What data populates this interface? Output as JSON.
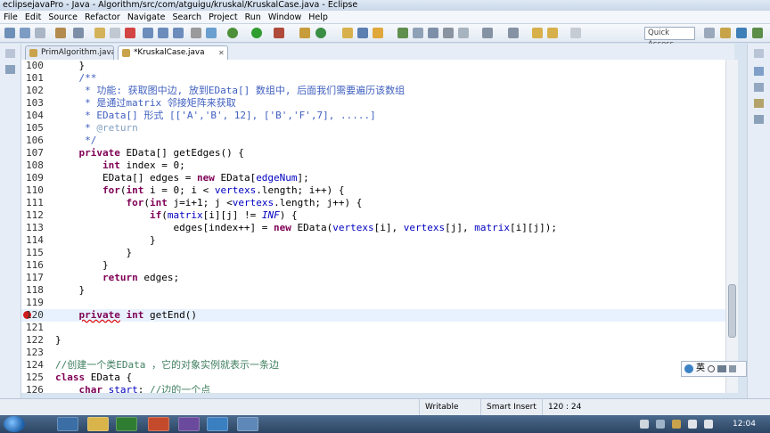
{
  "window": {
    "title": "eclipsejavaPro - Java - Algorithm/src/com/atguigu/kruskal/KruskalCase.java - Eclipse"
  },
  "menu": [
    "File",
    "Edit",
    "Source",
    "Refactor",
    "Navigate",
    "Search",
    "Project",
    "Run",
    "Window",
    "Help"
  ],
  "toolbar": {
    "quick_access": "Quick Access"
  },
  "tabs": [
    {
      "label": "PrimAlgorithm.java",
      "active": false
    },
    {
      "label": "*KruskalCase.java",
      "active": true
    }
  ],
  "editor": {
    "lines": [
      {
        "n": "100",
        "t": "    }"
      },
      {
        "n": "101",
        "t": "    /**"
      },
      {
        "n": "102",
        "t": "     * 功能: 获取图中边, 放到EData[] 数组中, 后面我们需要遍历该数组"
      },
      {
        "n": "103",
        "t": "     * 是通过matrix 邻接矩阵来获取"
      },
      {
        "n": "104",
        "t": "     * EData[] 形式 [['A','B', 12], ['B','F',7], .....]"
      },
      {
        "n": "105",
        "t": "     * @return"
      },
      {
        "n": "106",
        "t": "     */"
      },
      {
        "n": "107",
        "t": "    private EData[] getEdges() {"
      },
      {
        "n": "108",
        "t": "        int index = 0;"
      },
      {
        "n": "109",
        "t": "        EData[] edges = new EData[edgeNum];"
      },
      {
        "n": "110",
        "t": "        for(int i = 0; i < vertexs.length; i++) {"
      },
      {
        "n": "111",
        "t": "            for(int j=i+1; j <vertexs.length; j++) {"
      },
      {
        "n": "112",
        "t": "                if(matrix[i][j] != INF) {"
      },
      {
        "n": "113",
        "t": "                    edges[index++] = new EData(vertexs[i], vertexs[j], matrix[i][j]);"
      },
      {
        "n": "114",
        "t": "                }"
      },
      {
        "n": "115",
        "t": "            }"
      },
      {
        "n": "116",
        "t": "        }"
      },
      {
        "n": "117",
        "t": "        return edges;"
      },
      {
        "n": "118",
        "t": "    }"
      },
      {
        "n": "119",
        "t": ""
      },
      {
        "n": "120",
        "t": "    private int getEnd()"
      },
      {
        "n": "121",
        "t": ""
      },
      {
        "n": "122",
        "t": "}"
      },
      {
        "n": "123",
        "t": ""
      },
      {
        "n": "124",
        "t": "//创建一个类EData ，它的对象实例就表示一条边"
      },
      {
        "n": "125",
        "t": "class EData {"
      },
      {
        "n": "126",
        "t": "    char start; //边的一个点"
      }
    ]
  },
  "ime": {
    "lang": "英"
  },
  "status": {
    "writable": "Writable",
    "insert_mode": "Smart Insert",
    "position": "120 : 24"
  },
  "taskbar": {
    "clock": "12:04"
  }
}
